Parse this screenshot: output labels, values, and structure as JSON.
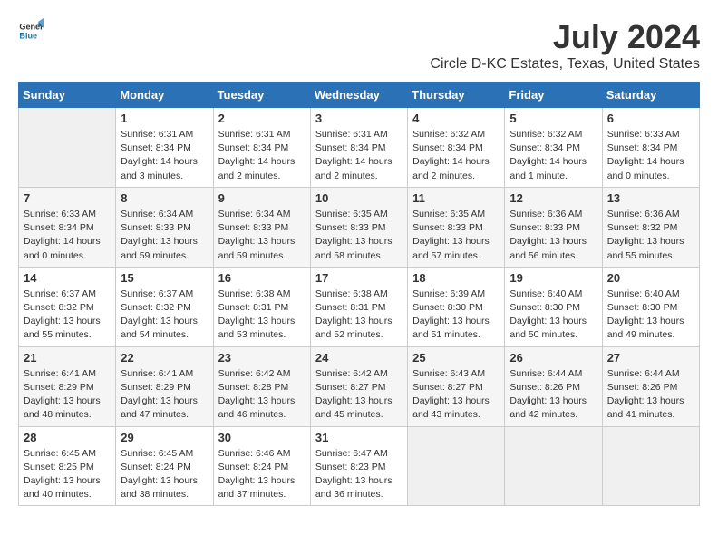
{
  "header": {
    "logo_general": "General",
    "logo_blue": "Blue",
    "month": "July 2024",
    "location": "Circle D-KC Estates, Texas, United States"
  },
  "calendar": {
    "days_of_week": [
      "Sunday",
      "Monday",
      "Tuesday",
      "Wednesday",
      "Thursday",
      "Friday",
      "Saturday"
    ],
    "weeks": [
      [
        {
          "date": "",
          "info": ""
        },
        {
          "date": "1",
          "info": "Sunrise: 6:31 AM\nSunset: 8:34 PM\nDaylight: 14 hours\nand 3 minutes."
        },
        {
          "date": "2",
          "info": "Sunrise: 6:31 AM\nSunset: 8:34 PM\nDaylight: 14 hours\nand 2 minutes."
        },
        {
          "date": "3",
          "info": "Sunrise: 6:31 AM\nSunset: 8:34 PM\nDaylight: 14 hours\nand 2 minutes."
        },
        {
          "date": "4",
          "info": "Sunrise: 6:32 AM\nSunset: 8:34 PM\nDaylight: 14 hours\nand 2 minutes."
        },
        {
          "date": "5",
          "info": "Sunrise: 6:32 AM\nSunset: 8:34 PM\nDaylight: 14 hours\nand 1 minute."
        },
        {
          "date": "6",
          "info": "Sunrise: 6:33 AM\nSunset: 8:34 PM\nDaylight: 14 hours\nand 0 minutes."
        }
      ],
      [
        {
          "date": "7",
          "info": "Sunrise: 6:33 AM\nSunset: 8:34 PM\nDaylight: 14 hours\nand 0 minutes."
        },
        {
          "date": "8",
          "info": "Sunrise: 6:34 AM\nSunset: 8:33 PM\nDaylight: 13 hours\nand 59 minutes."
        },
        {
          "date": "9",
          "info": "Sunrise: 6:34 AM\nSunset: 8:33 PM\nDaylight: 13 hours\nand 59 minutes."
        },
        {
          "date": "10",
          "info": "Sunrise: 6:35 AM\nSunset: 8:33 PM\nDaylight: 13 hours\nand 58 minutes."
        },
        {
          "date": "11",
          "info": "Sunrise: 6:35 AM\nSunset: 8:33 PM\nDaylight: 13 hours\nand 57 minutes."
        },
        {
          "date": "12",
          "info": "Sunrise: 6:36 AM\nSunset: 8:33 PM\nDaylight: 13 hours\nand 56 minutes."
        },
        {
          "date": "13",
          "info": "Sunrise: 6:36 AM\nSunset: 8:32 PM\nDaylight: 13 hours\nand 55 minutes."
        }
      ],
      [
        {
          "date": "14",
          "info": "Sunrise: 6:37 AM\nSunset: 8:32 PM\nDaylight: 13 hours\nand 55 minutes."
        },
        {
          "date": "15",
          "info": "Sunrise: 6:37 AM\nSunset: 8:32 PM\nDaylight: 13 hours\nand 54 minutes."
        },
        {
          "date": "16",
          "info": "Sunrise: 6:38 AM\nSunset: 8:31 PM\nDaylight: 13 hours\nand 53 minutes."
        },
        {
          "date": "17",
          "info": "Sunrise: 6:38 AM\nSunset: 8:31 PM\nDaylight: 13 hours\nand 52 minutes."
        },
        {
          "date": "18",
          "info": "Sunrise: 6:39 AM\nSunset: 8:30 PM\nDaylight: 13 hours\nand 51 minutes."
        },
        {
          "date": "19",
          "info": "Sunrise: 6:40 AM\nSunset: 8:30 PM\nDaylight: 13 hours\nand 50 minutes."
        },
        {
          "date": "20",
          "info": "Sunrise: 6:40 AM\nSunset: 8:30 PM\nDaylight: 13 hours\nand 49 minutes."
        }
      ],
      [
        {
          "date": "21",
          "info": "Sunrise: 6:41 AM\nSunset: 8:29 PM\nDaylight: 13 hours\nand 48 minutes."
        },
        {
          "date": "22",
          "info": "Sunrise: 6:41 AM\nSunset: 8:29 PM\nDaylight: 13 hours\nand 47 minutes."
        },
        {
          "date": "23",
          "info": "Sunrise: 6:42 AM\nSunset: 8:28 PM\nDaylight: 13 hours\nand 46 minutes."
        },
        {
          "date": "24",
          "info": "Sunrise: 6:42 AM\nSunset: 8:27 PM\nDaylight: 13 hours\nand 45 minutes."
        },
        {
          "date": "25",
          "info": "Sunrise: 6:43 AM\nSunset: 8:27 PM\nDaylight: 13 hours\nand 43 minutes."
        },
        {
          "date": "26",
          "info": "Sunrise: 6:44 AM\nSunset: 8:26 PM\nDaylight: 13 hours\nand 42 minutes."
        },
        {
          "date": "27",
          "info": "Sunrise: 6:44 AM\nSunset: 8:26 PM\nDaylight: 13 hours\nand 41 minutes."
        }
      ],
      [
        {
          "date": "28",
          "info": "Sunrise: 6:45 AM\nSunset: 8:25 PM\nDaylight: 13 hours\nand 40 minutes."
        },
        {
          "date": "29",
          "info": "Sunrise: 6:45 AM\nSunset: 8:24 PM\nDaylight: 13 hours\nand 38 minutes."
        },
        {
          "date": "30",
          "info": "Sunrise: 6:46 AM\nSunset: 8:24 PM\nDaylight: 13 hours\nand 37 minutes."
        },
        {
          "date": "31",
          "info": "Sunrise: 6:47 AM\nSunset: 8:23 PM\nDaylight: 13 hours\nand 36 minutes."
        },
        {
          "date": "",
          "info": ""
        },
        {
          "date": "",
          "info": ""
        },
        {
          "date": "",
          "info": ""
        }
      ]
    ]
  }
}
